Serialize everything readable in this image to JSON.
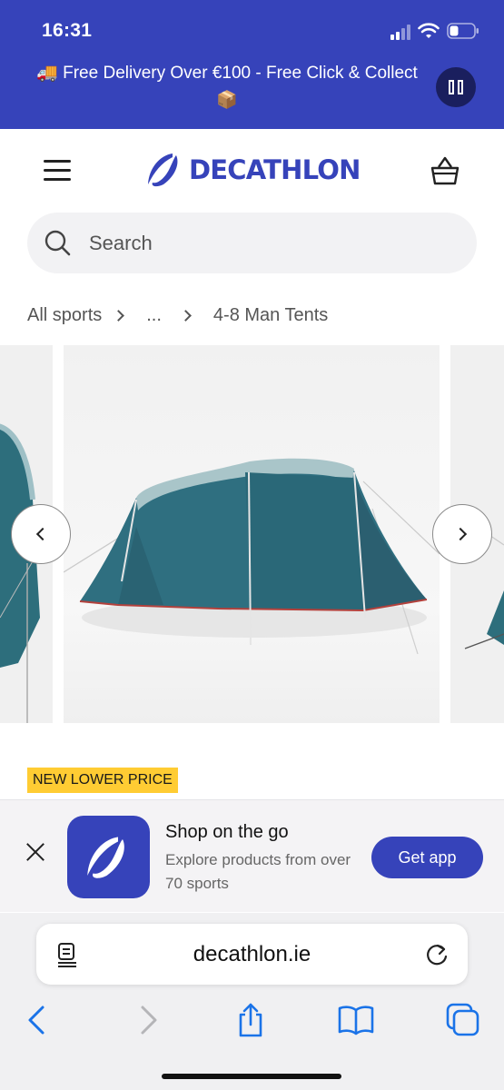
{
  "status_bar": {
    "time": "16:31"
  },
  "promo": {
    "text": "🚚 Free Delivery Over €100 - Free Click & Collect 📦"
  },
  "header": {
    "brand": "DECATHLON"
  },
  "search": {
    "placeholder": "Search"
  },
  "breadcrumb": {
    "items": [
      "All sports",
      "...",
      "4-8 Man Tents"
    ]
  },
  "product": {
    "badge": "NEW LOWER PRICE"
  },
  "app_banner": {
    "title": "Shop on the go",
    "subtitle": "Explore products from over 70 sports",
    "cta": "Get app"
  },
  "browser": {
    "url": "decathlon.ie"
  },
  "colors": {
    "brand": "#3643ba",
    "badge": "#ffcc33",
    "browser_accent": "#1a73e8"
  },
  "icons": [
    "menu-icon",
    "basket-icon",
    "search-icon",
    "chevron-left-icon",
    "chevron-right-icon",
    "close-icon",
    "reader-icon",
    "reload-icon",
    "back-icon",
    "forward-icon",
    "share-icon",
    "bookmarks-icon",
    "tabs-icon"
  ]
}
